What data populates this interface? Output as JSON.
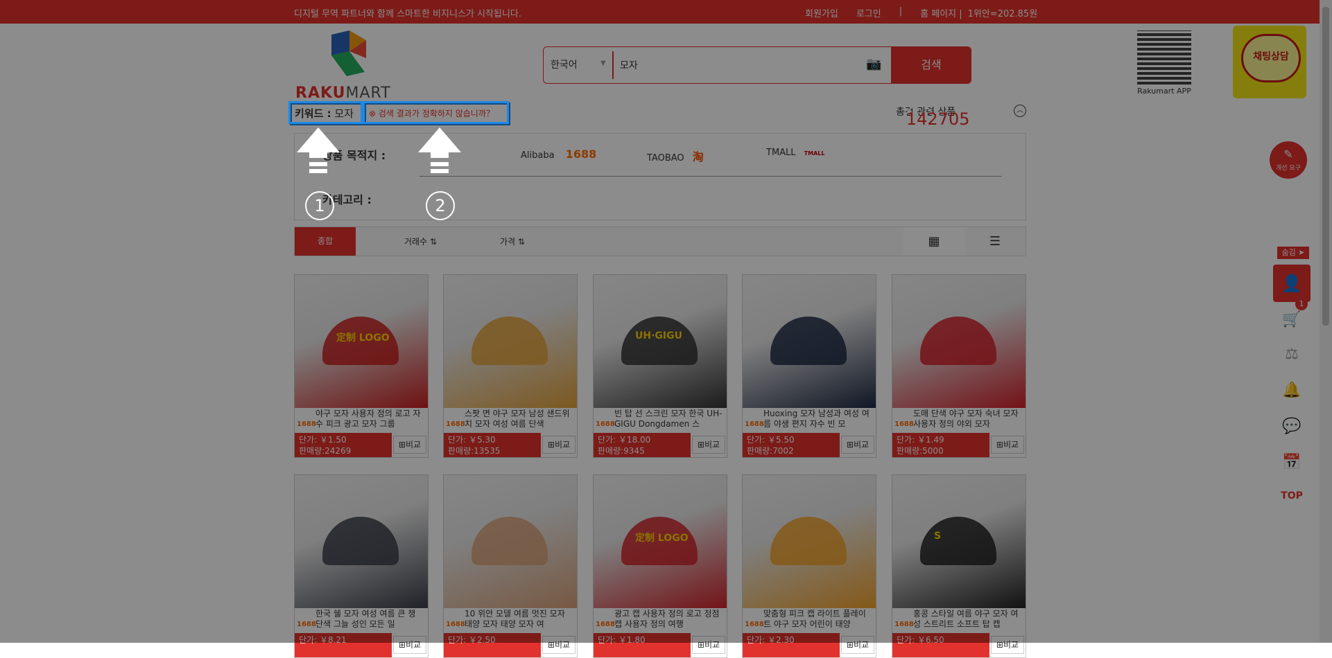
{
  "topbar": {
    "notice": "디지털 무역 파트너와 함께 스마트한 비지니스가 시작됩니다.",
    "signup": "회원가입",
    "login": "로그인",
    "sep": "|",
    "home": "홈 페이지 |",
    "rate": "1위안=202.85원"
  },
  "logo": {
    "part1": "RAKU",
    "part2": "MART"
  },
  "search": {
    "language": "한국어",
    "query": "모자",
    "button": "검색"
  },
  "qr": {
    "label": "Rakumart APP"
  },
  "chat": {
    "label": "채팅상담"
  },
  "keyword": {
    "label": "키워드 :",
    "value": "모자"
  },
  "inaccurate": "검색 결과가 정확하지 않습니까？",
  "total": {
    "prefix": "총",
    "count": "142705",
    "suffix": "건 관련 상품"
  },
  "filter": {
    "destination_label": "상품 목적지 :",
    "category_label": "카테고리 :",
    "sources": [
      {
        "name": "Alibaba",
        "mark": "1688"
      },
      {
        "name": "TAOBAO",
        "mark": "淘"
      },
      {
        "name": "TMALL",
        "mark": "TMALL"
      }
    ]
  },
  "sort": {
    "all": "종합",
    "volume": "거래수",
    "price": "가격"
  },
  "annotations": {
    "n1": "1",
    "n2": "2"
  },
  "products": [
    {
      "title": "야구 모자 사용자 정의 로고 자수 피크 광고 모자 그룹",
      "price": "단가: ￥1.50",
      "sales": "판매량:24269",
      "img_text": "定制 LOGO",
      "color": "#c9201f"
    },
    {
      "title": "스팟 면 야구 모자 남성 샌드위치 모자 여성 여름 단색",
      "price": "단가: ￥5.30",
      "sales": "판매량:13535",
      "img_text": "",
      "color": "#e3a23b"
    },
    {
      "title": "빈 탑 선 스크린 모자 한국 UH-GIGU Dongdamen 스",
      "price": "단가: ￥18.00",
      "sales": "판매량:9345",
      "img_text": "UH·GIGU",
      "color": "#333"
    },
    {
      "title": "Huoxing 모자 남성과 여성 여름 야생 편지 자수 빈 모",
      "price": "단가: ￥5.50",
      "sales": "판매량:7002",
      "img_text": "",
      "color": "#1f2a44"
    },
    {
      "title": "도매 단색 야구 모자 숙녀 모자 사용자 정의 야외 모자",
      "price": "단가: ￥1.49",
      "sales": "판매량:5000",
      "img_text": "",
      "color": "#d3212b"
    },
    {
      "title": "한국 쉘 모자 여성 여름 큰 챙 단색 그늘 성인 모든 일",
      "price": "단가: ￥8.21",
      "sales": "",
      "img_text": "",
      "color": "#3b3f4a"
    },
    {
      "title": "10 위안 모델 여름 멋진 모자 태양 모자 태양 모자 여",
      "price": "단가: ￥2.50",
      "sales": "",
      "img_text": "",
      "color": "#d9a27a"
    },
    {
      "title": "광고 캡 사용자 정의 로고 정점 캡 사용자 정의 여행",
      "price": "단가: ￥1.80",
      "sales": "",
      "img_text": "定制 LOGO",
      "color": "#d0242b"
    },
    {
      "title": "맞춤형 피크 캡 라이트 플레이트 야구 모자 어린이 태양",
      "price": "단가: ￥2.30",
      "sales": "",
      "img_text": "",
      "color": "#f2a22b"
    },
    {
      "title": "홍콩 스타일 여름 야구 모자 여성 스트리트 소프트 탑 캡",
      "price": "단가: ￥6.50",
      "sales": "",
      "img_text": "S",
      "color": "#222"
    }
  ],
  "compare": "비교",
  "rail": {
    "hide": "숨김 ➤",
    "cart_badge": "1",
    "top": "TOP",
    "improve": "개선 요구"
  }
}
